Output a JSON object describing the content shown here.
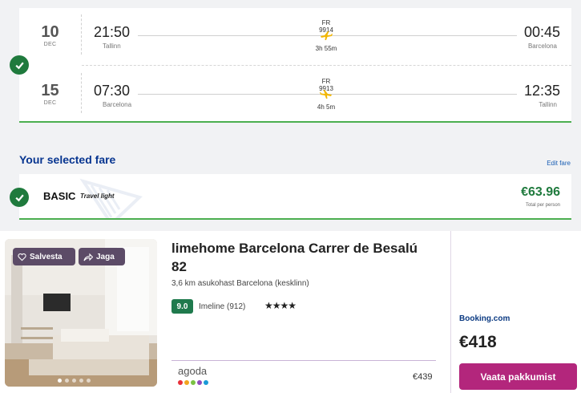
{
  "flight": {
    "outbound": {
      "day": "10",
      "month": "DEC",
      "dep_time": "21:50",
      "dep_city": "Tallinn",
      "flight_no": "FR 9914",
      "duration": "3h 55m",
      "arr_time": "00:45",
      "arr_city": "Barcelona"
    },
    "return": {
      "day": "15",
      "month": "DEC",
      "dep_time": "07:30",
      "dep_city": "Barcelona",
      "flight_no": "FR 9913",
      "duration": "4h 5m",
      "arr_time": "12:35",
      "arr_city": "Tallinn"
    }
  },
  "fare": {
    "heading": "Your selected fare",
    "edit_label": "Edit fare",
    "name": "BASIC",
    "subtitle": "Travel light",
    "price": "€63.96",
    "per": "Total per person"
  },
  "hotel": {
    "save_label": "Salvesta",
    "share_label": "Jaga",
    "name": "limehome Barcelona Carrer de Besalú 82",
    "distance": "3,6 km asukohast Barcelona (kesklinn)",
    "rating": "9.0",
    "rating_text": "Imeline (912)",
    "stars": "★★★★",
    "photo_dots": 5,
    "alt_provider": "agoda",
    "alt_price": "€439",
    "provider": "Booking.com",
    "price": "€418",
    "cta": "Vaata pakkumist"
  },
  "colors": {
    "success": "#1f7a3d",
    "brand_blue": "#073590",
    "cta": "#b3267c",
    "chip": "#5c4b67"
  },
  "icons": [
    "check-icon",
    "plane-icon",
    "heart-icon",
    "share-icon"
  ]
}
